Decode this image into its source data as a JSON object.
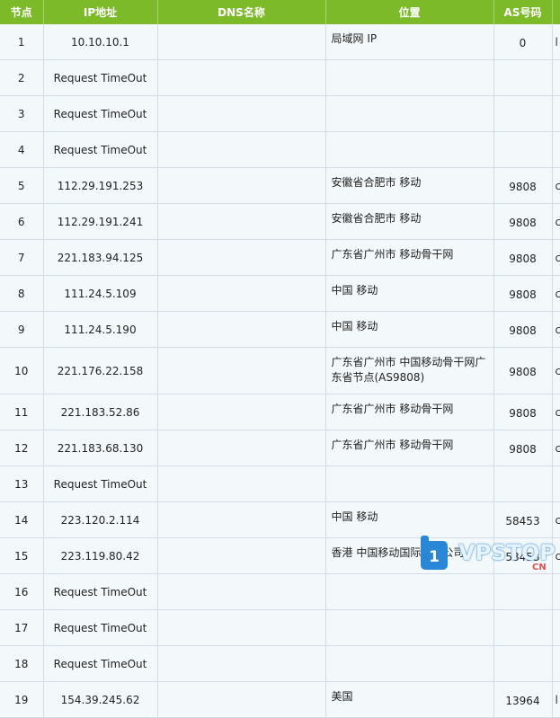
{
  "table": {
    "headers": [
      "节点",
      "IP地址",
      "DNS名称",
      "位置",
      "AS号码"
    ],
    "rows": [
      {
        "hop": "1",
        "ip": "10.10.10.1",
        "dns": "",
        "location": "局域网 IP",
        "asn": "0",
        "extra": "l"
      },
      {
        "hop": "2",
        "ip": "Request TimeOut",
        "dns": "",
        "location": "",
        "asn": "",
        "extra": ""
      },
      {
        "hop": "3",
        "ip": "Request TimeOut",
        "dns": "",
        "location": "",
        "asn": "",
        "extra": ""
      },
      {
        "hop": "4",
        "ip": "Request TimeOut",
        "dns": "",
        "location": "",
        "asn": "",
        "extra": ""
      },
      {
        "hop": "5",
        "ip": "112.29.191.253",
        "dns": "",
        "location": "安徽省合肥市 移动",
        "asn": "9808",
        "extra": "c"
      },
      {
        "hop": "6",
        "ip": "112.29.191.241",
        "dns": "",
        "location": "安徽省合肥市 移动",
        "asn": "9808",
        "extra": "c"
      },
      {
        "hop": "7",
        "ip": "221.183.94.125",
        "dns": "",
        "location": "广东省广州市 移动骨干网",
        "asn": "9808",
        "extra": "c"
      },
      {
        "hop": "8",
        "ip": "111.24.5.109",
        "dns": "",
        "location": "中国 移动",
        "asn": "9808",
        "extra": "c"
      },
      {
        "hop": "9",
        "ip": "111.24.5.190",
        "dns": "",
        "location": "中国 移动",
        "asn": "9808",
        "extra": "c"
      },
      {
        "hop": "10",
        "ip": "221.176.22.158",
        "dns": "",
        "location": "广东省广州市 中国移动骨干网广东省节点(AS9808)",
        "asn": "9808",
        "extra": "c"
      },
      {
        "hop": "11",
        "ip": "221.183.52.86",
        "dns": "",
        "location": "广东省广州市 移动骨干网",
        "asn": "9808",
        "extra": "c"
      },
      {
        "hop": "12",
        "ip": "221.183.68.130",
        "dns": "",
        "location": "广东省广州市 移动骨干网",
        "asn": "9808",
        "extra": "c"
      },
      {
        "hop": "13",
        "ip": "Request TimeOut",
        "dns": "",
        "location": "",
        "asn": "",
        "extra": ""
      },
      {
        "hop": "14",
        "ip": "223.120.2.114",
        "dns": "",
        "location": "中国 移动",
        "asn": "58453",
        "extra": "c"
      },
      {
        "hop": "15",
        "ip": "223.119.80.42",
        "dns": "",
        "location": "香港 中国移动国际有限公司",
        "asn": "58453",
        "extra": "c"
      },
      {
        "hop": "16",
        "ip": "Request TimeOut",
        "dns": "",
        "location": "",
        "asn": "",
        "extra": ""
      },
      {
        "hop": "17",
        "ip": "Request TimeOut",
        "dns": "",
        "location": "",
        "asn": "",
        "extra": ""
      },
      {
        "hop": "18",
        "ip": "Request TimeOut",
        "dns": "",
        "location": "",
        "asn": "",
        "extra": ""
      },
      {
        "hop": "19",
        "ip": "154.39.245.62",
        "dns": "",
        "location": "美国",
        "asn": "13964",
        "extra": "l"
      }
    ]
  },
  "watermark": {
    "mark": "1",
    "text": "VPSTOP",
    "sub": "CN"
  }
}
